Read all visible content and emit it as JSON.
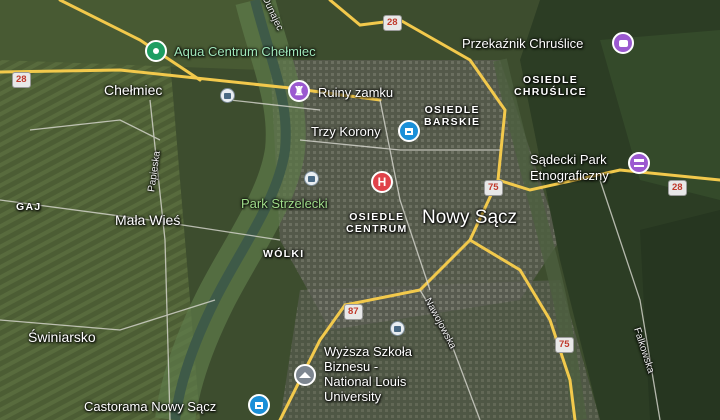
{
  "map": {
    "places": {
      "aqua_centrum": "Aqua Centrum Chełmiec",
      "chelmiec": "Chełmiec",
      "ruiny_zamku": "Ruiny zamku",
      "trzy_korony": "Trzy Korony",
      "przekaznik": "Przekaźnik Chruślice",
      "osiedle_chruslice_1": "OSIEDLE",
      "osiedle_chruslice_2": "CHRUŚLICE",
      "osiedle_barskie_1": "OSIEDLE",
      "osiedle_barskie_2": "BARSKIE",
      "sadecki_park_1": "Sądecki Park",
      "sadecki_park_2": "Etnograficzny",
      "gaj": "GAJ",
      "mala_wies": "Mała Wieś",
      "park_strzelecki": "Park Strzelecki",
      "osiedle_centrum_1": "OSIEDLE",
      "osiedle_centrum_2": "CENTRUM",
      "nowy_sacz": "Nowy Sącz",
      "wolki": "WÓLKI",
      "swiniarsko": "Świniarsko",
      "wyzsza_szkola_1": "Wyższa Szkoła",
      "wyzsza_szkola_2": "Biznesu -",
      "wyzsza_szkola_3": "National Louis",
      "wyzsza_szkola_4": "University",
      "castorama": "Castorama Nowy Sącz"
    },
    "streets": {
      "papieska": "Papieska",
      "nawojowska": "Nawojowska",
      "falkowska": "Falkowska",
      "dunajec": "Dunajec"
    },
    "road_shields": {
      "r28_west": "28",
      "r28_north": "28",
      "r28_east": "28",
      "r75_center": "75",
      "r75_south": "75",
      "r87": "87"
    },
    "icons": {
      "aqua": "map-pin-icon",
      "ruiny": "castle-icon",
      "trzy_korony": "shopping-bag-icon",
      "przekaznik": "camera-icon",
      "sadecki": "museum-icon",
      "hospital": "hospital-icon",
      "school": "graduation-cap-icon",
      "castorama": "shopping-bag-icon",
      "transit": "train-station-icon"
    },
    "hospital_letter": "H",
    "colors": {
      "poi_green": "#1e9e62",
      "poi_purple": "#9b59d0",
      "poi_blue": "#1a8fd8",
      "poi_red": "#e0424a",
      "poi_gray": "#7d8690",
      "road_yellow": "#f2c94c",
      "park_text": "#9fdc8a"
    }
  }
}
